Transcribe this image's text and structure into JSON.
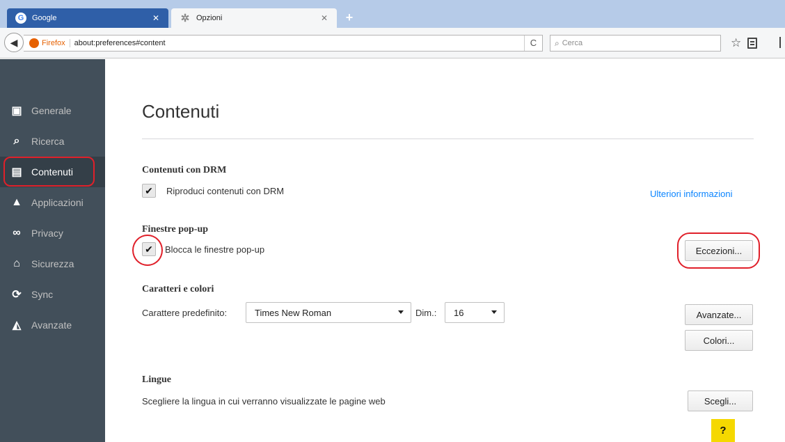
{
  "tabs": [
    {
      "label": "Google",
      "icon": "google-logo-icon",
      "close": "✕"
    },
    {
      "label": "Opzioni",
      "icon": "gear-icon",
      "close": "✕"
    }
  ],
  "new_tab": "+",
  "navbar": {
    "back_icon": "back-arrow-icon",
    "identity": "Firefox",
    "url": "about:preferences#content",
    "reload_icon": "C",
    "search_placeholder": "Cerca"
  },
  "sidebar": {
    "items": [
      {
        "label": "Generale",
        "icon": "general-icon"
      },
      {
        "label": "Ricerca",
        "icon": "search-icon"
      },
      {
        "label": "Contenuti",
        "icon": "content-icon",
        "selected": true
      },
      {
        "label": "Applicazioni",
        "icon": "applications-icon"
      },
      {
        "label": "Privacy",
        "icon": "privacy-mask-icon"
      },
      {
        "label": "Sicurezza",
        "icon": "security-icon"
      },
      {
        "label": "Sync",
        "icon": "sync-icon"
      },
      {
        "label": "Avanzate",
        "icon": "advanced-icon"
      }
    ]
  },
  "content": {
    "title": "Contenuti",
    "drm": {
      "heading": "Contenuti con DRM",
      "checkbox_label": "Riproduci contenuti con DRM",
      "checked": true,
      "learn_more": "Ulteriori informazioni"
    },
    "popups": {
      "heading": "Finestre pop-up",
      "checkbox_label": "Blocca le finestre pop-up",
      "checked": true,
      "exceptions_button": "Eccezioni..."
    },
    "fonts": {
      "heading": "Caratteri e colori",
      "default_font_label": "Carattere predefinito:",
      "default_font_value": "Times New Roman",
      "size_label": "Dim.:",
      "size_value": "16",
      "advanced_button": "Avanzate...",
      "colors_button": "Colori..."
    },
    "languages": {
      "heading": "Lingue",
      "description": "Scegliere la lingua in cui verranno visualizzate le pagine web",
      "choose_button": "Scegli..."
    },
    "help_button": "?"
  },
  "colors": {
    "annotation_red": "#e0202a",
    "sidebar_bg": "#424f5a",
    "link_blue": "#0a84ff",
    "help_yellow": "#f5d800"
  }
}
